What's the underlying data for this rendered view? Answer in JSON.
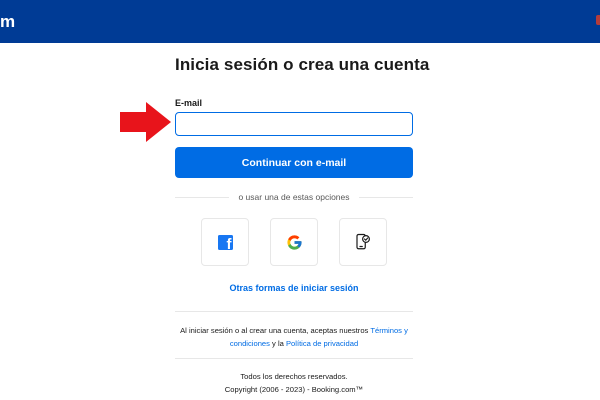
{
  "header": {
    "logo_fragment": "m",
    "background_color": "#003b95"
  },
  "main": {
    "title": "Inicia sesión o crea una cuenta",
    "email": {
      "label": "E-mail",
      "value": "",
      "placeholder": ""
    },
    "continue_button": "Continuar con e-mail",
    "divider_text": "o usar una de estas opciones",
    "social": [
      {
        "name": "facebook",
        "icon": "facebook-icon"
      },
      {
        "name": "google",
        "icon": "google-icon"
      },
      {
        "name": "passkey",
        "icon": "passkey-phone-icon"
      }
    ],
    "other_options_link": "Otras formas de iniciar sesión",
    "legal": {
      "prefix": "Al iniciar sesión o al crear una cuenta, aceptas nuestros ",
      "terms_link": "Términos y condiciones",
      "connector": " y la ",
      "privacy_link": "Política de privacidad"
    },
    "footer": {
      "rights": "Todos los derechos reservados.",
      "copyright": "Copyright (2006 - 2023) - Booking.com™"
    }
  },
  "annotation": {
    "arrow_color": "#e8141b"
  },
  "colors": {
    "brand_dark": "#003b95",
    "accent": "#006ce4",
    "facebook": "#1877f2",
    "text": "#1a1a1a"
  }
}
